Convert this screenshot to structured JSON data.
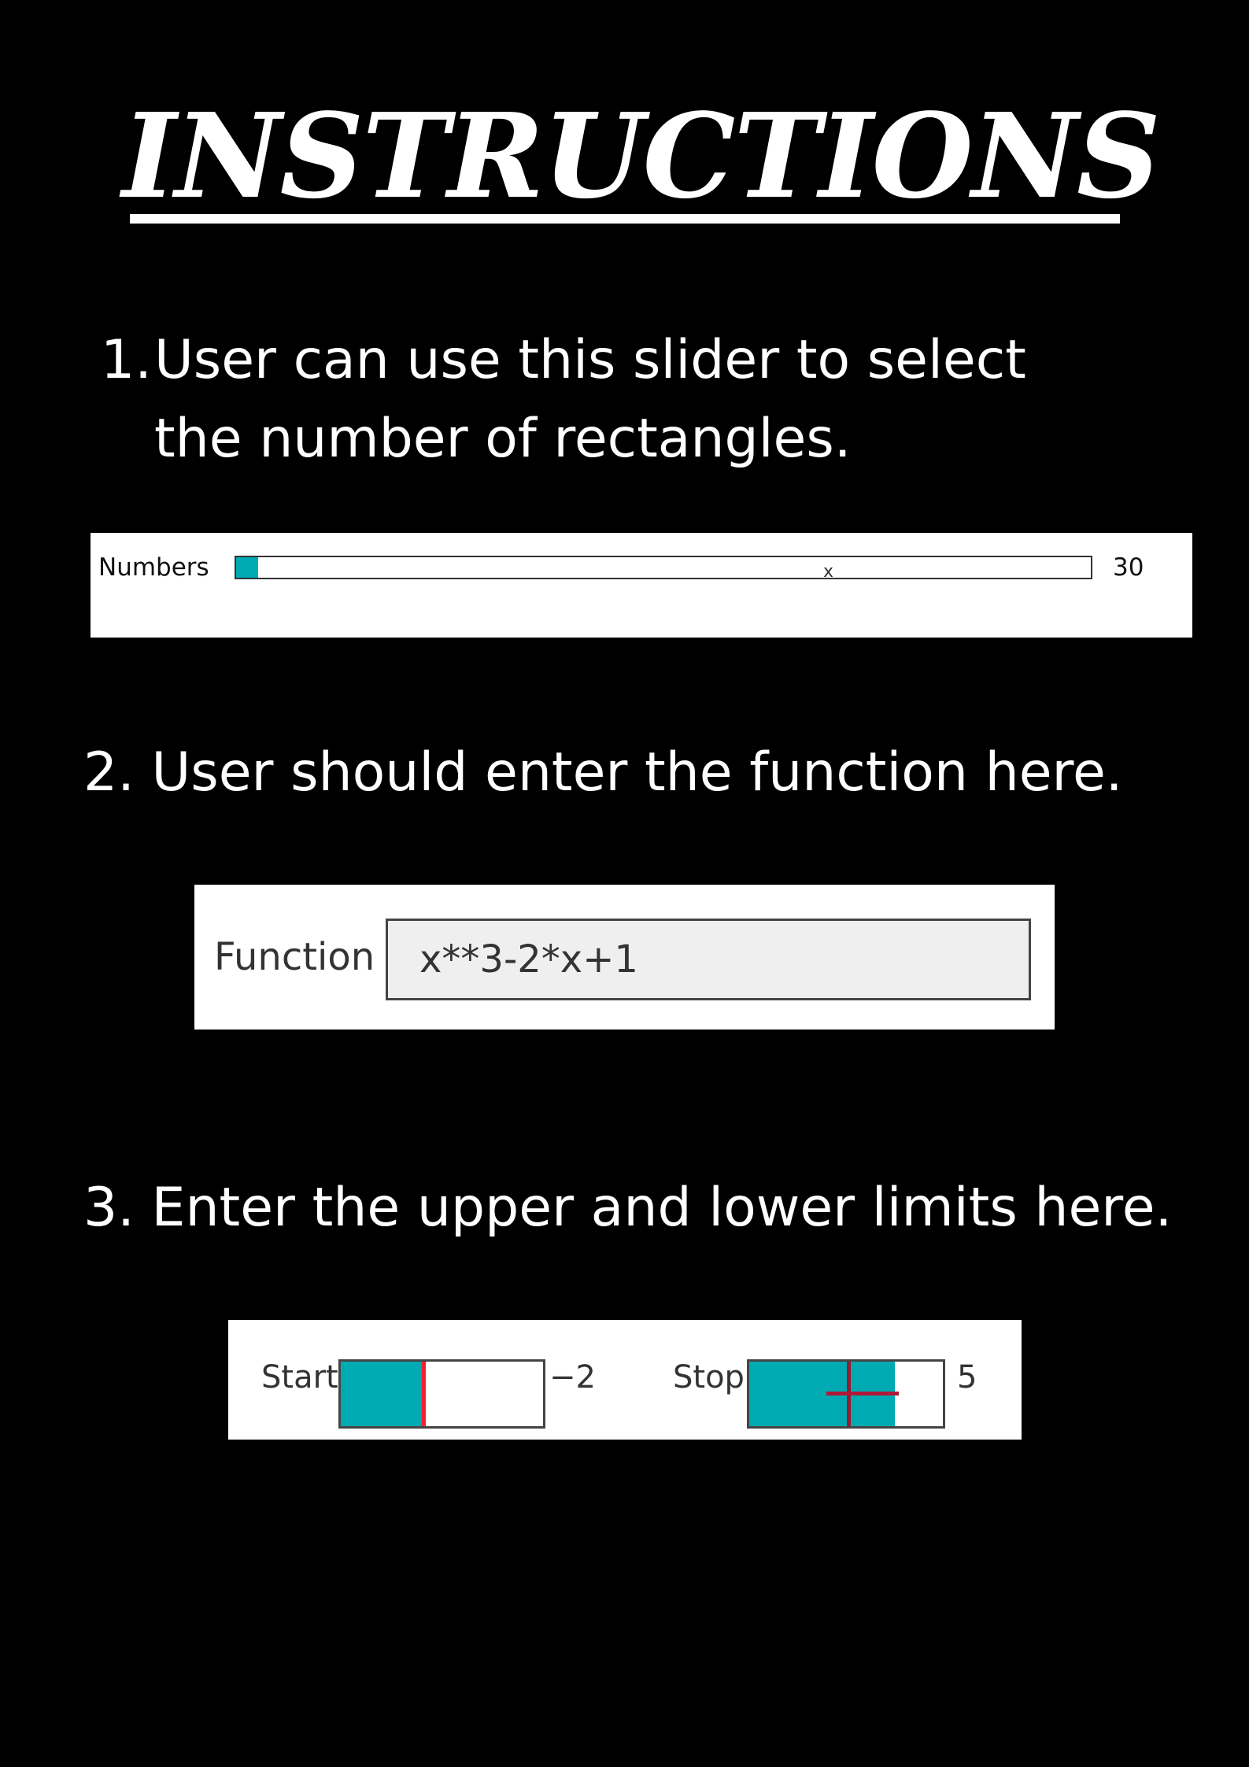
{
  "title": "INSTRUCTIONS",
  "steps": {
    "one_number": "1.",
    "one_text": "User can use this slider to select the number of rectangles.",
    "two": "2. User should enter the function here.",
    "three": "3. Enter the upper and lower limits here."
  },
  "numbers_slider": {
    "label": "Numbers",
    "mark": "x",
    "value": "30",
    "fill_fraction": 0.026
  },
  "function_box": {
    "label": "Function",
    "value": "x**3-2*x+1"
  },
  "limits": {
    "start": {
      "label": "Start",
      "value": "−2",
      "fill_fraction": 0.41
    },
    "stop": {
      "label": "Stop",
      "value": "5",
      "fill_fraction": 0.75
    }
  },
  "colors": {
    "background": "#000000",
    "panel": "#ffffff",
    "slider_fill": "#00aab3",
    "initial_marker": "#ee2233"
  }
}
